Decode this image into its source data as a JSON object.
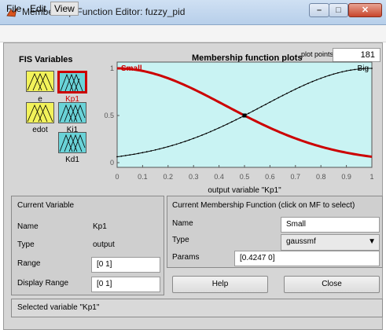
{
  "window": {
    "title": "Membership Function Editor: fuzzy_pid"
  },
  "menubar": {
    "file": "File",
    "edit": "Edit",
    "view": "View"
  },
  "fis": {
    "title": "FIS Variables",
    "inputs": [
      {
        "label": "e"
      },
      {
        "label": "edot"
      }
    ],
    "outputs": [
      {
        "label": "Kp1",
        "selected": true
      },
      {
        "label": "Ki1"
      },
      {
        "label": "Kd1"
      }
    ]
  },
  "plot": {
    "title": "Membership function plots",
    "plot_points_label": "plot points:",
    "plot_points_value": "181",
    "xlabel": "output variable \"Kp1\"",
    "colors": {
      "background": "#c9f3f3",
      "selected_mf": "#cc0000",
      "other_mf": "#000000"
    }
  },
  "chart_data": {
    "type": "line",
    "xlim": [
      0,
      1
    ],
    "ylim": [
      0,
      1
    ],
    "x_ticks": [
      "0",
      "0.1",
      "0.2",
      "0.3",
      "0.4",
      "0.5",
      "0.6",
      "0.7",
      "0.8",
      "0.9",
      "1"
    ],
    "y_ticks": [
      "0",
      "0.5",
      "1"
    ],
    "xlabel": "output variable \"Kp1\"",
    "series": [
      {
        "name": "Small",
        "mf_type": "gaussmf",
        "params": [
          0.4247,
          0
        ],
        "selected": true
      },
      {
        "name": "Big",
        "mf_type": "gaussmf",
        "params": [
          0.4247,
          1
        ],
        "selected": false
      }
    ]
  },
  "current_variable": {
    "header": "Current Variable",
    "name_label": "Name",
    "name_value": "Kp1",
    "type_label": "Type",
    "type_value": "output",
    "range_label": "Range",
    "range_value": "[0 1]",
    "display_range_label": "Display Range",
    "display_range_value": "[0 1]"
  },
  "current_mf": {
    "header": "Current Membership Function (click on MF to select)",
    "name_label": "Name",
    "name_value": "Small",
    "type_label": "Type",
    "type_value": "gaussmf",
    "params_label": "Params",
    "params_value": "[0.4247 0]"
  },
  "buttons": {
    "help": "Help",
    "close": "Close"
  },
  "status": {
    "text": "Selected variable \"Kp1\""
  }
}
